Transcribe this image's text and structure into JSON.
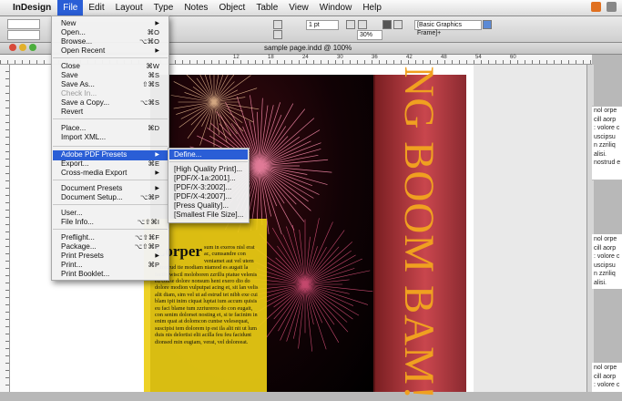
{
  "menubar": {
    "app": "InDesign",
    "items": [
      "File",
      "Edit",
      "Layout",
      "Type",
      "Notes",
      "Object",
      "Table",
      "View",
      "Window",
      "Help"
    ]
  },
  "control": {
    "stroke_weight": "1 pt",
    "zoom_pct": "30%",
    "frame_style": "[Basic Graphics Frame]+"
  },
  "document": {
    "title": "sample page.indd @ 100%"
  },
  "ruler": {
    "h_numbers": [
      "12",
      "18",
      "24",
      "30",
      "36",
      "42",
      "48",
      "54",
      "60"
    ]
  },
  "file_menu": [
    {
      "label": "New",
      "shortcut": "",
      "submenu": true
    },
    {
      "label": "Open...",
      "shortcut": "⌘O"
    },
    {
      "label": "Browse...",
      "shortcut": "⌥⌘O"
    },
    {
      "label": "Open Recent",
      "shortcut": "",
      "submenu": true
    },
    {
      "label": "Close",
      "shortcut": "⌘W"
    },
    {
      "label": "Save",
      "shortcut": "⌘S"
    },
    {
      "label": "Save As...",
      "shortcut": "⇧⌘S"
    },
    {
      "label": "Check In...",
      "shortcut": "",
      "disabled": true
    },
    {
      "label": "Save a Copy...",
      "shortcut": "⌥⌘S"
    },
    {
      "label": "Revert",
      "shortcut": ""
    },
    {
      "label": "Place...",
      "shortcut": "⌘D"
    },
    {
      "label": "Import XML...",
      "shortcut": ""
    },
    {
      "label": "Adobe PDF Presets",
      "shortcut": "",
      "submenu": true,
      "highlighted": true
    },
    {
      "label": "Export...",
      "shortcut": "⌘E"
    },
    {
      "label": "Cross-media Export",
      "shortcut": "",
      "submenu": true
    },
    {
      "label": "Document Presets",
      "shortcut": "",
      "submenu": true
    },
    {
      "label": "Document Setup...",
      "shortcut": "⌥⌘P"
    },
    {
      "label": "User...",
      "shortcut": ""
    },
    {
      "label": "File Info...",
      "shortcut": "⌥⇧⌘I"
    },
    {
      "label": "Preflight...",
      "shortcut": "⌥⇧⌘F"
    },
    {
      "label": "Package...",
      "shortcut": "⌥⇧⌘P"
    },
    {
      "label": "Print Presets",
      "shortcut": "",
      "submenu": true
    },
    {
      "label": "Print...",
      "shortcut": "⌘P"
    },
    {
      "label": "Print Booklet...",
      "shortcut": ""
    }
  ],
  "pdf_submenu": [
    "Define...",
    "[High Quality Print]...",
    "[PDF/X-1a:2001]...",
    "[PDF/X-3:2002]...",
    "[PDF/X-4:2007]...",
    "[Press Quality]...",
    "[Smallest File Size]..."
  ],
  "artwork": {
    "headline": "NG BOOM BAM!",
    "dropcap": "Lorper",
    "body": "sum in exeros nisl erat ac, cumsandre con veniamet aut vel utem verostrud tie modiam niamod es augait la facilit wiscil moloboren zzrillu ptatue velenis eu conse dolore nonsum hent exero dio do dolore modion vulputpat acing et, sit lan velis alit diam, sim vel ut ad estrud tet nibh exe cui blam ipit inim ciquat luptat ium accum quisis eu faci blame tum zzriureros do con eugait, con senim dolorset nosting et, si te facinim in enim quat at dolomcon cuntse velesequat, suscipisi tem dolorem ip est ila alit nit ut lum duis nis delortisi elit acilla feu feu facidunt dionsed min eugiam, verat, vel doloreeat."
  },
  "right_frames": [
    [
      "nol orpe",
      "cill aorp",
      ": volore c",
      "uscipsu",
      "n zzriliq",
      " alisi.",
      "nostrud e"
    ],
    [
      "nol orpe",
      "cill aorp",
      ": volore c",
      "uscipsu",
      "n zzriliq",
      " alisi."
    ],
    [
      "nol orpe",
      "cill aorp",
      ": volore c"
    ]
  ]
}
